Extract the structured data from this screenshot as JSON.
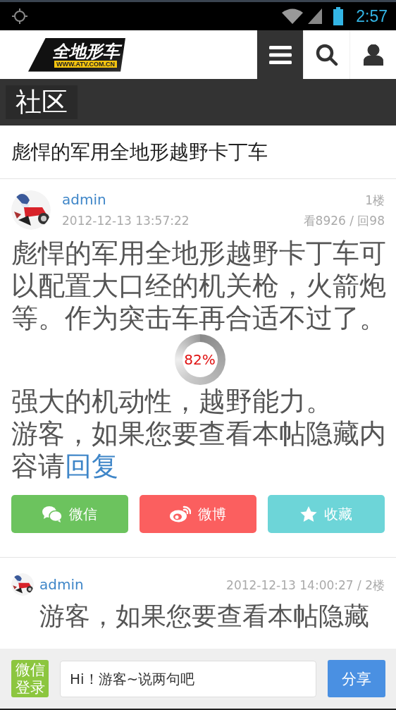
{
  "status_bar": {
    "time": "2:57"
  },
  "header": {
    "logo": {
      "title": "全地形车",
      "url": "WWW.ATV.COM.CN"
    },
    "nav": [
      {
        "kind": "menu",
        "selected": true
      },
      {
        "kind": "search",
        "selected": false
      },
      {
        "kind": "user",
        "selected": false
      }
    ]
  },
  "section": {
    "title": "社区"
  },
  "thread_title": "彪悍的军用全地形越野卡丁车",
  "posts": [
    {
      "kind": "first",
      "user": "admin",
      "time": "2012-12-13 13:57:22",
      "floor": "1楼",
      "stats": "看8926 / 回98",
      "paragraphs": [
        {
          "text": "彪悍的军用全地形越野卡丁车可以配置大口经的机关枪，火箭炮等。作为突击车再合适不过了。"
        },
        {
          "text": "强大的机动性，越野能力。"
        },
        {
          "text": "游客，如果您要查看本帖隐藏内容请",
          "link": "回复"
        }
      ],
      "loading": {
        "text": "82%"
      },
      "share_buttons": [
        {
          "kind": "wechat",
          "label": "微信"
        },
        {
          "kind": "weibo",
          "label": "微博"
        },
        {
          "kind": "favorite",
          "label": "收藏"
        }
      ]
    },
    {
      "kind": "reply",
      "user": "admin",
      "meta": "2012-12-13 14:00:27 / 2楼",
      "paragraphs": [
        {
          "text": "游客，如果您要查看本帖隐藏"
        }
      ]
    }
  ],
  "bottom_bar": {
    "login": "微信登录",
    "input": {
      "placeholder": "Hi！游客~说两句吧"
    },
    "button": "分享"
  }
}
